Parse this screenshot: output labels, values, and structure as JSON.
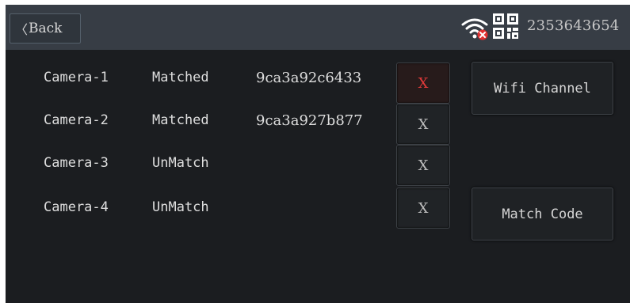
{
  "header": {
    "back_label": "Back",
    "device_id": "2353643654",
    "icons": [
      "chevron-left-icon",
      "wifi-disconnected-icon",
      "qr-code-icon"
    ],
    "wifi_color": "#ffffff",
    "alert_color": "#e03030"
  },
  "cameras": [
    {
      "name": "Camera-1",
      "status": "Matched",
      "code": "9ca3a92c6433",
      "remove_label": "X",
      "selected": true
    },
    {
      "name": "Camera-2",
      "status": "Matched",
      "code": "9ca3a927b877",
      "remove_label": "X",
      "selected": false
    },
    {
      "name": "Camera-3",
      "status": "UnMatch",
      "code": "",
      "remove_label": "X",
      "selected": false
    },
    {
      "name": "Camera-4",
      "status": "UnMatch",
      "code": "",
      "remove_label": "X",
      "selected": false
    }
  ],
  "side": {
    "wifi_channel_label": "Wifi Channel",
    "match_code_label": "Match Code"
  },
  "colors": {
    "background": "#1b1d20",
    "header_bar": "#373d45",
    "selected_x": "#e03a3a"
  }
}
